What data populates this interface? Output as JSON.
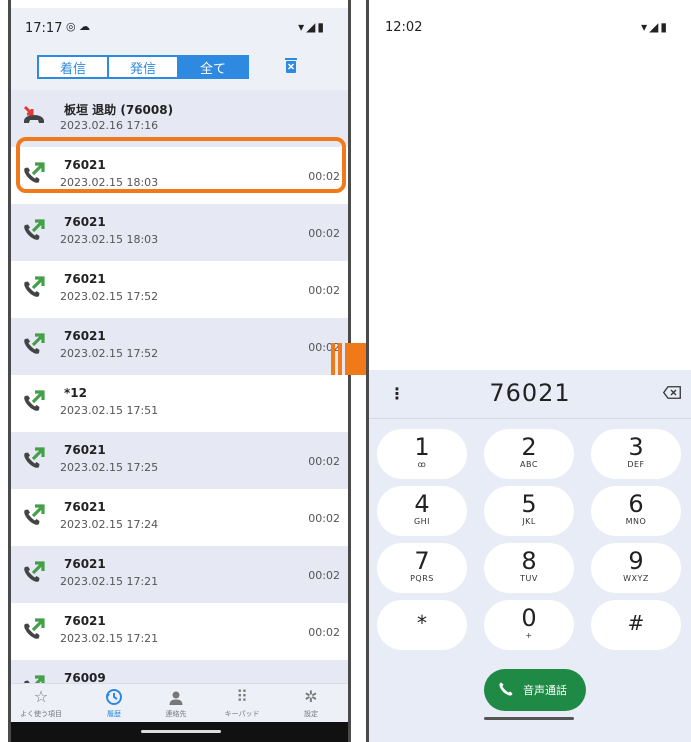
{
  "left": {
    "status": {
      "time": "17:17",
      "icons": "◎ ☁",
      "right_icons": "▾◢▮"
    },
    "tabs": [
      {
        "label": "着信"
      },
      {
        "label": "発信"
      },
      {
        "label": "全て",
        "active": true
      }
    ],
    "calls": [
      {
        "name": "板垣 退助 (76008)",
        "date": "2023.02.16 17:16",
        "duration": "",
        "type": "missed"
      },
      {
        "name": "76021",
        "date": "2023.02.15 18:03",
        "duration": "00:02",
        "type": "outgoing",
        "highlighted": true
      },
      {
        "name": "76021",
        "date": "2023.02.15 18:03",
        "duration": "00:02",
        "type": "outgoing"
      },
      {
        "name": "76021",
        "date": "2023.02.15 17:52",
        "duration": "00:02",
        "type": "outgoing"
      },
      {
        "name": "76021",
        "date": "2023.02.15 17:52",
        "duration": "00:02",
        "type": "outgoing"
      },
      {
        "name": "*12",
        "date": "2023.02.15 17:51",
        "duration": "",
        "type": "outgoing"
      },
      {
        "name": "76021",
        "date": "2023.02.15 17:25",
        "duration": "00:02",
        "type": "outgoing"
      },
      {
        "name": "76021",
        "date": "2023.02.15 17:24",
        "duration": "00:02",
        "type": "outgoing"
      },
      {
        "name": "76021",
        "date": "2023.02.15 17:21",
        "duration": "00:02",
        "type": "outgoing"
      },
      {
        "name": "76021",
        "date": "2023.02.15 17:21",
        "duration": "00:02",
        "type": "outgoing"
      },
      {
        "name": "76009",
        "date": "",
        "duration": "",
        "type": "outgoing"
      }
    ],
    "nav": [
      {
        "label": "よく使う項目",
        "icon": "star-icon",
        "glyph": "☆"
      },
      {
        "label": "履歴",
        "icon": "history-icon",
        "glyph": "",
        "active": true
      },
      {
        "label": "連絡先",
        "icon": "person-icon",
        "glyph": ""
      },
      {
        "label": "キーパッド",
        "icon": "keypad-icon",
        "glyph": "⠿"
      },
      {
        "label": "設定",
        "icon": "gear-icon",
        "glyph": "✲"
      }
    ]
  },
  "right": {
    "status": {
      "time": "12:02",
      "right_icons": "▾◢▮"
    },
    "number": "76021",
    "keys": [
      {
        "digit": "1",
        "letters": "ꝏ"
      },
      {
        "digit": "2",
        "letters": "ABC"
      },
      {
        "digit": "3",
        "letters": "DEF"
      },
      {
        "digit": "4",
        "letters": "GHI"
      },
      {
        "digit": "5",
        "letters": "JKL"
      },
      {
        "digit": "6",
        "letters": "MNO"
      },
      {
        "digit": "7",
        "letters": "PQRS"
      },
      {
        "digit": "8",
        "letters": "TUV"
      },
      {
        "digit": "9",
        "letters": "WXYZ"
      },
      {
        "digit": "*",
        "letters": ""
      },
      {
        "digit": "0",
        "letters": "+"
      },
      {
        "digit": "#",
        "letters": ""
      }
    ],
    "call_label": "音声通話"
  },
  "colors": {
    "accent": "#2d8ae0",
    "highlight": "#f07a1a",
    "call_green": "#1e8a45",
    "row_alt": "#e6e9f4"
  }
}
